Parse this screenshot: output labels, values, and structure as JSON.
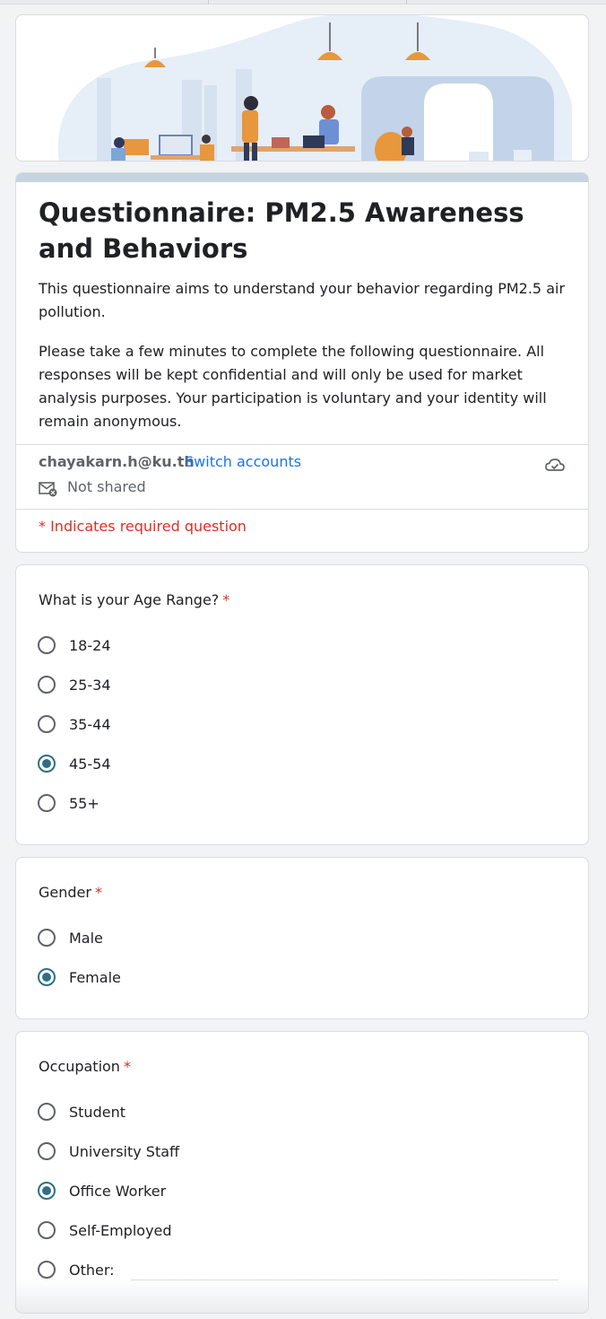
{
  "form": {
    "title": "Questionnaire: PM2.5 Awareness and Behaviors",
    "description_1": "This questionnaire aims to understand your behavior regarding PM2.5 air pollution.",
    "description_2": "Please take a few minutes to complete the following questionnaire. All responses will be kept confidential and will only be used for market analysis purposes. Your participation is voluntary and your identity will remain anonymous.",
    "account_email": "chayakarn.h@ku.th",
    "switch_accounts": "Switch accounts",
    "not_shared": "Not shared",
    "required_note": "* Indicates required question"
  },
  "questions": {
    "age": {
      "title": "What is your Age Range?",
      "required_mark": "*",
      "options": [
        "18-24",
        "25-34",
        "35-44",
        "45-54",
        "55+"
      ],
      "selected": "45-54"
    },
    "gender": {
      "title": "Gender",
      "required_mark": "*",
      "options": [
        "Male",
        "Female"
      ],
      "selected": "Female"
    },
    "occupation": {
      "title": "Occupation",
      "required_mark": "*",
      "options": [
        "Student",
        "University Staff",
        "Office Worker",
        "Self-Employed",
        "Other:"
      ],
      "selected": "Office Worker"
    }
  },
  "icons": {
    "cloud": "cloud-saved-icon",
    "mail": "mail-not-shared-icon",
    "radio": "radio-button-icon"
  },
  "colors": {
    "accent": "#c6d3e1",
    "radio_checked": "#2f6f86",
    "link": "#1a73e8",
    "required": "#d93025"
  }
}
